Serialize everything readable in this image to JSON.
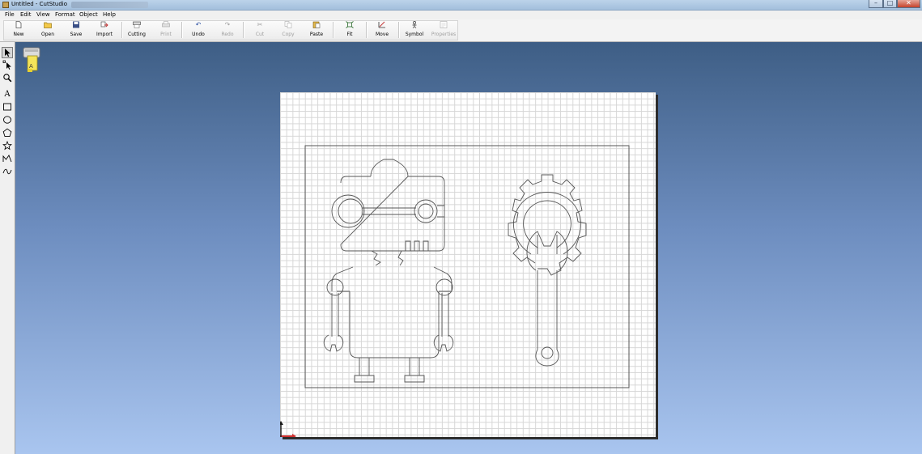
{
  "window": {
    "title": "Untitled - CutStudio",
    "controls": [
      "minimize",
      "maximize",
      "close"
    ]
  },
  "menu": {
    "items": [
      "File",
      "Edit",
      "View",
      "Format",
      "Object",
      "Help"
    ]
  },
  "toolbar": {
    "new": "New",
    "open": "Open",
    "save": "Save",
    "import": "Import",
    "cutting": "Cutting",
    "print": "Print",
    "undo": "Undo",
    "redo": "Redo",
    "cut": "Cut",
    "copy": "Copy",
    "paste": "Paste",
    "fit": "Fit",
    "move": "Move",
    "symbol": "Symbol",
    "properties": "Properties"
  },
  "toolbox": {
    "tools": [
      "select-arrow-icon",
      "edit-points-icon",
      "zoom-icon",
      "text-icon",
      "rectangle-icon",
      "ellipse-icon",
      "polygon-icon",
      "star-icon",
      "polyline-icon",
      "freehand-curve-icon"
    ],
    "selected": "select-arrow-icon"
  },
  "workspace": {
    "background_top": "#3e5e85",
    "background_bottom": "#a9c5ef",
    "paper_color": "#ffffff",
    "grid_color": "#d6d6d6"
  },
  "canvas": {
    "objects": [
      "robot-outline",
      "gear-wrench-outline",
      "bounding-rectangle"
    ],
    "origin_axes": {
      "x_color": "#d03030",
      "y_color": "#1a1a1a"
    }
  }
}
